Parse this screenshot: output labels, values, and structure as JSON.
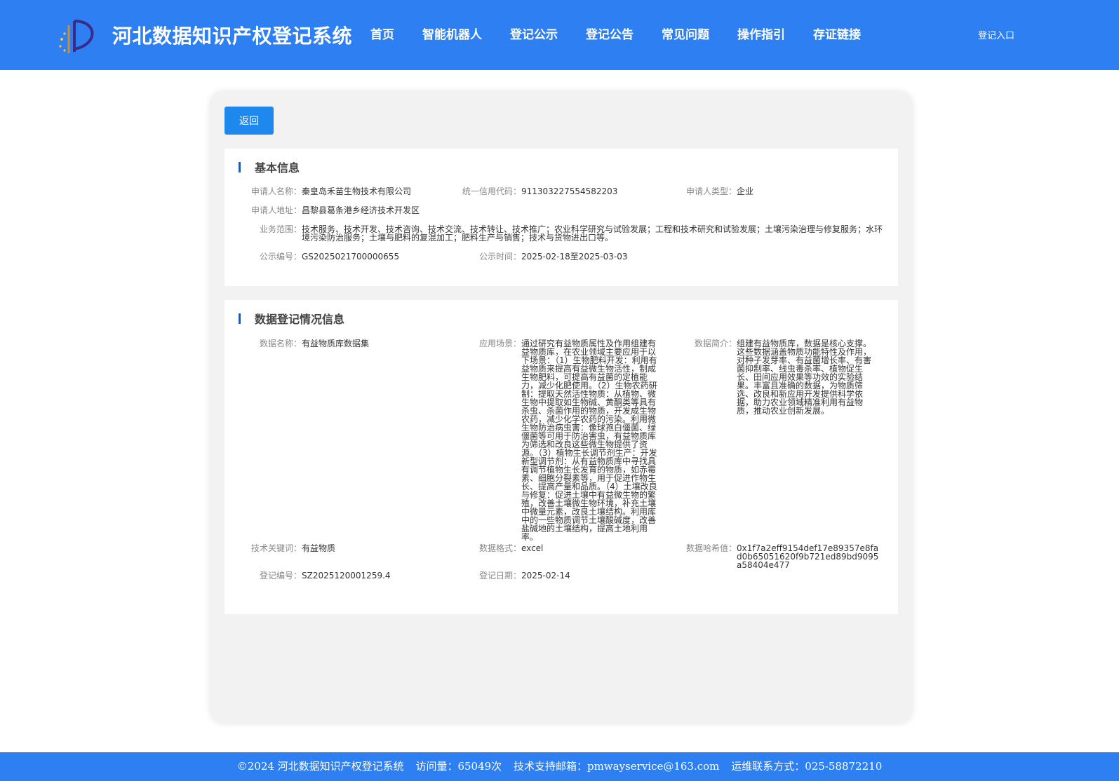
{
  "header": {
    "title": "河北数据知识产权登记系统",
    "nav": [
      "首页",
      "智能机器人",
      "登记公示",
      "登记公告",
      "常见问题",
      "操作指引",
      "存证链接"
    ],
    "login_label": "登记入口"
  },
  "back_label": "返回",
  "basic": {
    "title": "基本信息",
    "applicant_name_label": "申请人名称：",
    "applicant_name": "秦皇岛禾苗生物技术有限公司",
    "credit_code_label": "统一信用代码：",
    "credit_code": "911303227554582203",
    "applicant_type_label": "申请人类型：",
    "applicant_type": "企业",
    "address_label": "申请人地址：",
    "address": "昌黎县葛条港乡经济技术开发区",
    "scope_label": "业务范围：",
    "scope": "技术服务、技术开发、技术咨询、技术交流、技术转让、技术推广；农业科学研究与试验发展；工程和技术研究和试验发展；土壤污染治理与修复服务；水环境污染防治服务；土壤与肥料的复混加工；肥料生产与销售；技术与货物进出口等。",
    "notice_no_label": "公示编号：",
    "notice_no": "GS2025021700000655",
    "notice_time_label": "公示时间：",
    "notice_time": "2025-02-18至2025-03-03"
  },
  "data_reg": {
    "title": "数据登记情况信息",
    "name_label": "数据名称：",
    "name": "有益物质库数据集",
    "scene_label": "应用场景：",
    "scene": "通过研究有益物质属性及作用组建有益物质库，在农业领域主要应用于以下场景：（1）生物肥料开发：利用有益物质来提高有益微生物活性，制成生物肥料，可提高有益菌的定植能力，减少化肥使用。（2）生物农药研制：提取天然活性物质：从植物、微生物中提取如生物碱、黄酮类等具有杀虫、杀菌作用的物质，开发成生物农药，减少化学农药的污染。利用微生物防治病虫害：像球孢白僵菌、绿僵菌等可用于防治害虫，有益物质库为筛选和改良这些微生物提供了资源。（3）植物生长调节剂生产：开发新型调节剂：从有益物质库中寻找具有调节植物生长发育的物质，如赤霉素、细胞分裂素等，用于促进作物生长、提高产量和品质。（4）土壤改良与修复：促进土壤中有益微生物的繁殖，改善土壤微生物环境，补充土壤中微量元素，改良土壤结构。利用库中的一些物质调节土壤酸碱度，改善盐碱地的土壤结构，提高土地利用率。",
    "intro_label": "数据简介：",
    "intro": "组建有益物质库，数据是核心支撑。这些数据涵盖物质功能特性及作用，对种子发芽率、有益菌增长率、有害菌抑制率、线虫毒杀率、植物促生长、田间应用效果等功效的实验结果。丰富且准确的数据，为物质筛选、改良和新应用开发提供科学依据，助力农业领域精准利用有益物质，推动农业创新发展。",
    "keyword_label": "技术关键词：",
    "keyword": "有益物质",
    "format_label": "数据格式：",
    "format": "excel",
    "hash_label": "数据哈希值：",
    "hash": "0x1f7a2eff9154def17e89357e8fad0b65051620f9b721ed89bd9095a58404e477",
    "reg_no_label": "登记编号：",
    "reg_no": "SZ2025120001259.4",
    "reg_date_label": "登记日期：",
    "reg_date": "2025-02-14"
  },
  "footer": {
    "copyright": "©2024 河北数据知识产权登记系统",
    "visits": "访问量：65049次",
    "email": "技术支持邮箱：pmwayservice@163.com",
    "contact": "运维联系方式：025-58872210"
  },
  "colors": {
    "header_bg": "#2d7ff2",
    "button_bg": "#1e88ee",
    "section_bar": "#1d5bb5"
  }
}
